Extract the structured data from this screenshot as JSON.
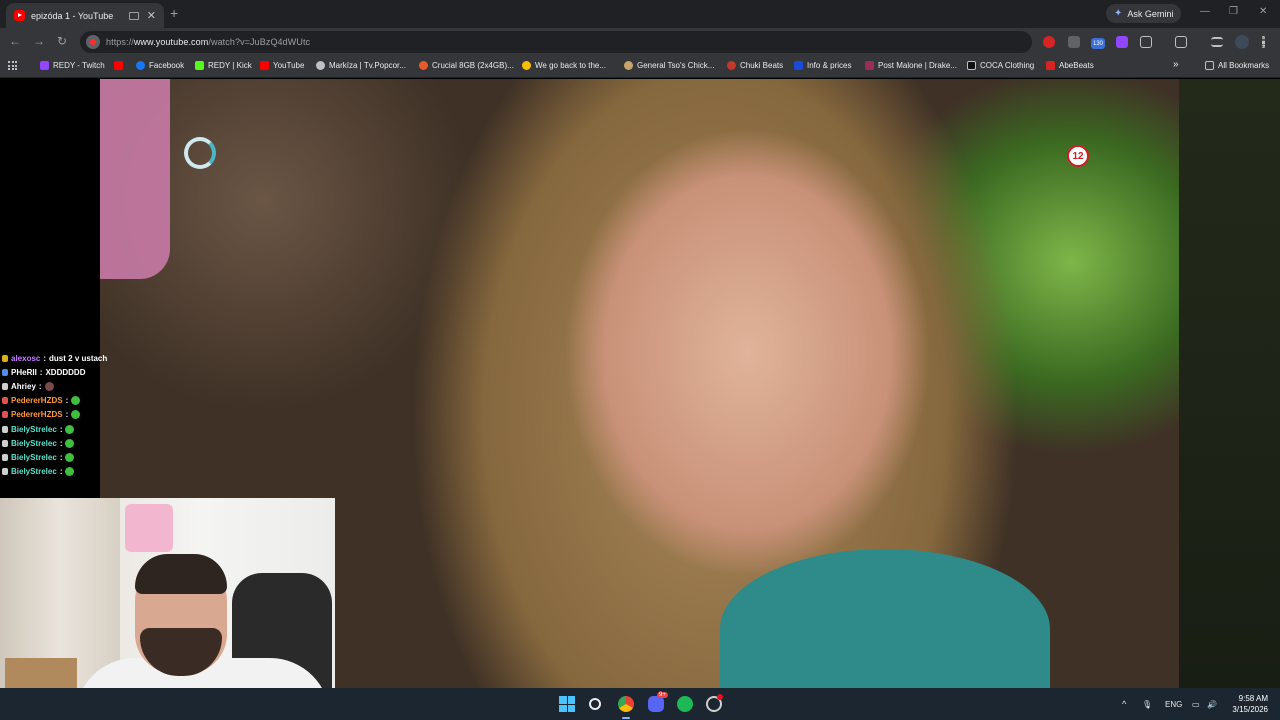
{
  "browser": {
    "tab": {
      "title": "epizóda 1 - YouTube",
      "close": "✕"
    },
    "new_tab": "+",
    "ask_gemini": "Ask Gemini",
    "window_controls": {
      "minimize": "—",
      "restore": "❐",
      "close": "✕"
    },
    "nav": {
      "back": "←",
      "forward": "→",
      "reload": "↻"
    },
    "url": {
      "prefix": "https://",
      "host": "www.youtube.com",
      "path": "/watch?v=JuBzQ4dWUtc"
    },
    "extension_badge": "130"
  },
  "bookmarks": {
    "items": [
      {
        "label": "REDY - Twitch",
        "color": "#9146ff"
      },
      {
        "label": "",
        "color": "#ff0000"
      },
      {
        "label": "Facebook",
        "color": "#1877f2"
      },
      {
        "label": "REDY | Kick",
        "color": "#53fc18"
      },
      {
        "label": "YouTube",
        "color": "#ff0000"
      },
      {
        "label": "Markíza | Tv.Popcor...",
        "color": "#bdc1c6"
      },
      {
        "label": "Crucial 8GB (2x4GB)...",
        "color": "#e8592b"
      },
      {
        "label": "We go back to the...",
        "color": "#fbbc05"
      },
      {
        "label": "General Tso's Chick...",
        "color": "#c8a46a"
      },
      {
        "label": "Chuki Beats",
        "color": "#c0392b"
      },
      {
        "label": "Info & prices",
        "color": "#1a4bd6"
      },
      {
        "label": "Post Malone | Drake...",
        "color": "#9b2c56"
      },
      {
        "label": "COCA Clothing",
        "color": "#111111"
      },
      {
        "label": "AbeBeats",
        "color": "#d62424"
      }
    ],
    "overflow": "»",
    "all_bookmarks": "All Bookmarks"
  },
  "video": {
    "rating": "12"
  },
  "chat": [
    {
      "user": "alexosc",
      "text": "dust 2 v ustach",
      "color": "#c77dff",
      "badge": "#e0b010"
    },
    {
      "user": "PHeRII",
      "text": "XDDDDDD",
      "color": "#ffffff",
      "badge": "#4a8ef0"
    },
    {
      "user": "Ahriey",
      "text": "",
      "color": "#ffffff",
      "badge": "#cfcfcf",
      "emote": "alt"
    },
    {
      "user": "PedererHZDS",
      "text": "",
      "color": "#ff9b3d",
      "badge": "#e05050",
      "emote": "green"
    },
    {
      "user": "PedererHZDS",
      "text": "",
      "color": "#ff9b3d",
      "badge": "#e05050",
      "emote": "green"
    },
    {
      "user": "BielyStrelec",
      "text": "",
      "color": "#5de0c9",
      "badge": "#cfcfcf",
      "emote": "green"
    },
    {
      "user": "BielyStrelec",
      "text": "",
      "color": "#5de0c9",
      "badge": "#cfcfcf",
      "emote": "green"
    },
    {
      "user": "BielyStrelec",
      "text": "",
      "color": "#5de0c9",
      "badge": "#cfcfcf",
      "emote": "green"
    },
    {
      "user": "BielyStrelec",
      "text": "",
      "color": "#5de0c9",
      "badge": "#cfcfcf",
      "emote": "green"
    }
  ],
  "taskbar": {
    "discord_badge": "9+",
    "tray": {
      "language": "ENG",
      "chevron": "^"
    },
    "clock": {
      "time": "9:58 AM",
      "date": "3/15/2026"
    }
  }
}
